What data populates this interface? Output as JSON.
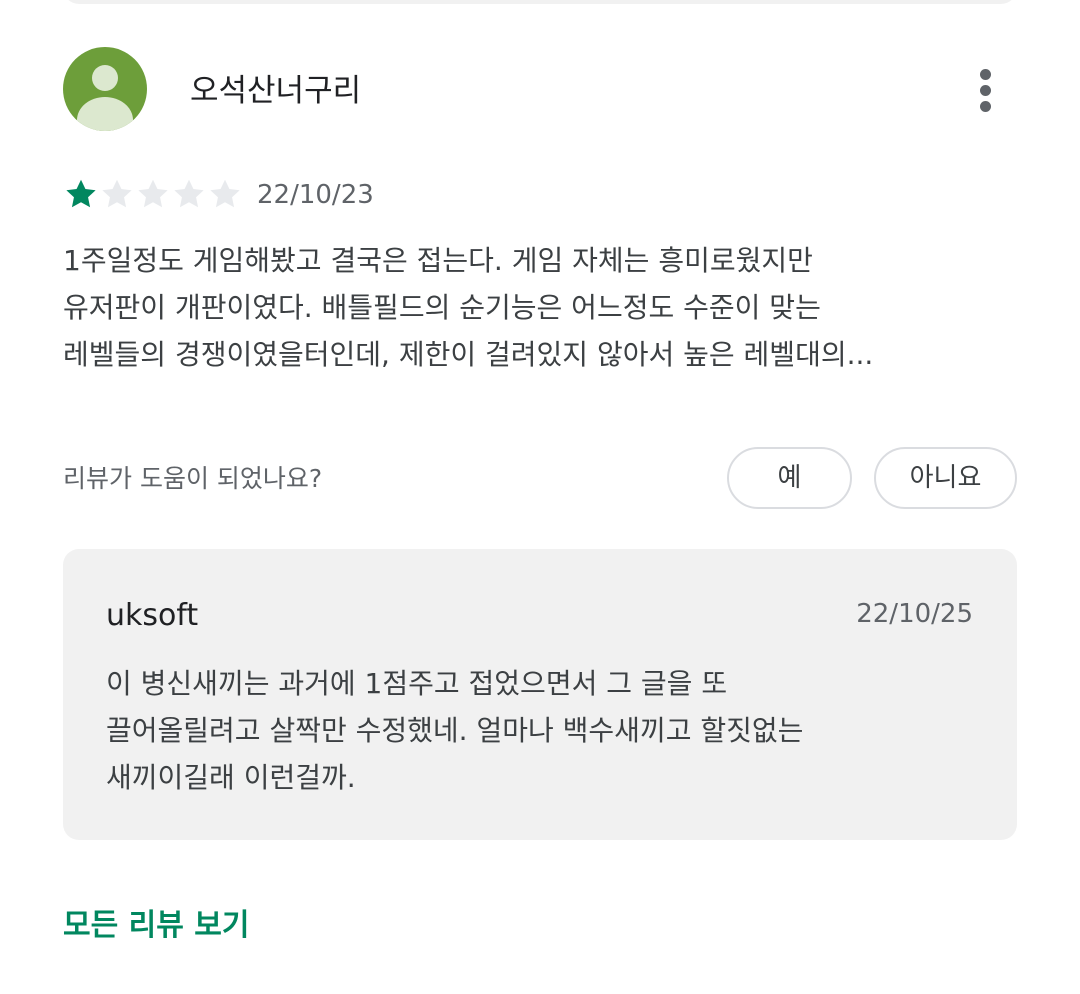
{
  "review": {
    "author": "오석산너구리",
    "rating": 1,
    "max_rating": 5,
    "date": "22/10/23",
    "text_lines": [
      "1주일정도 게임해봤고 결국은 접는다. 게임 자체는 흥미로웠지만",
      "유저판이 개판이였다. 배틀필드의 순기능은 어느정도 수준이 맞는",
      "레벨들의 경쟁이였을터인데, 제한이 걸려있지 않아서 높은 레벨대의..."
    ],
    "avatar_icon": "person-avatar-icon",
    "more_icon": "more-vert-icon"
  },
  "helpful": {
    "question": "리뷰가 도움이 되었나요?",
    "yes_label": "예",
    "no_label": "아니요"
  },
  "developer_reply": {
    "name": "uksoft",
    "date": "22/10/25",
    "text_lines": [
      "이 병신새끼는 과거에 1점주고 접었으면서 그 글을 또",
      "끌어올릴려고 살짝만 수정했네. 얼마나 백수새끼고 할짓없는",
      "새끼이길래 이런걸까."
    ]
  },
  "footer": {
    "all_reviews_label": "모든 리뷰 보기"
  },
  "colors": {
    "accent": "#01875f",
    "star_filled": "#01875f",
    "star_empty": "#e8eaed",
    "avatar_bg": "#6d9e3a",
    "card_bg": "#f1f1f1"
  }
}
